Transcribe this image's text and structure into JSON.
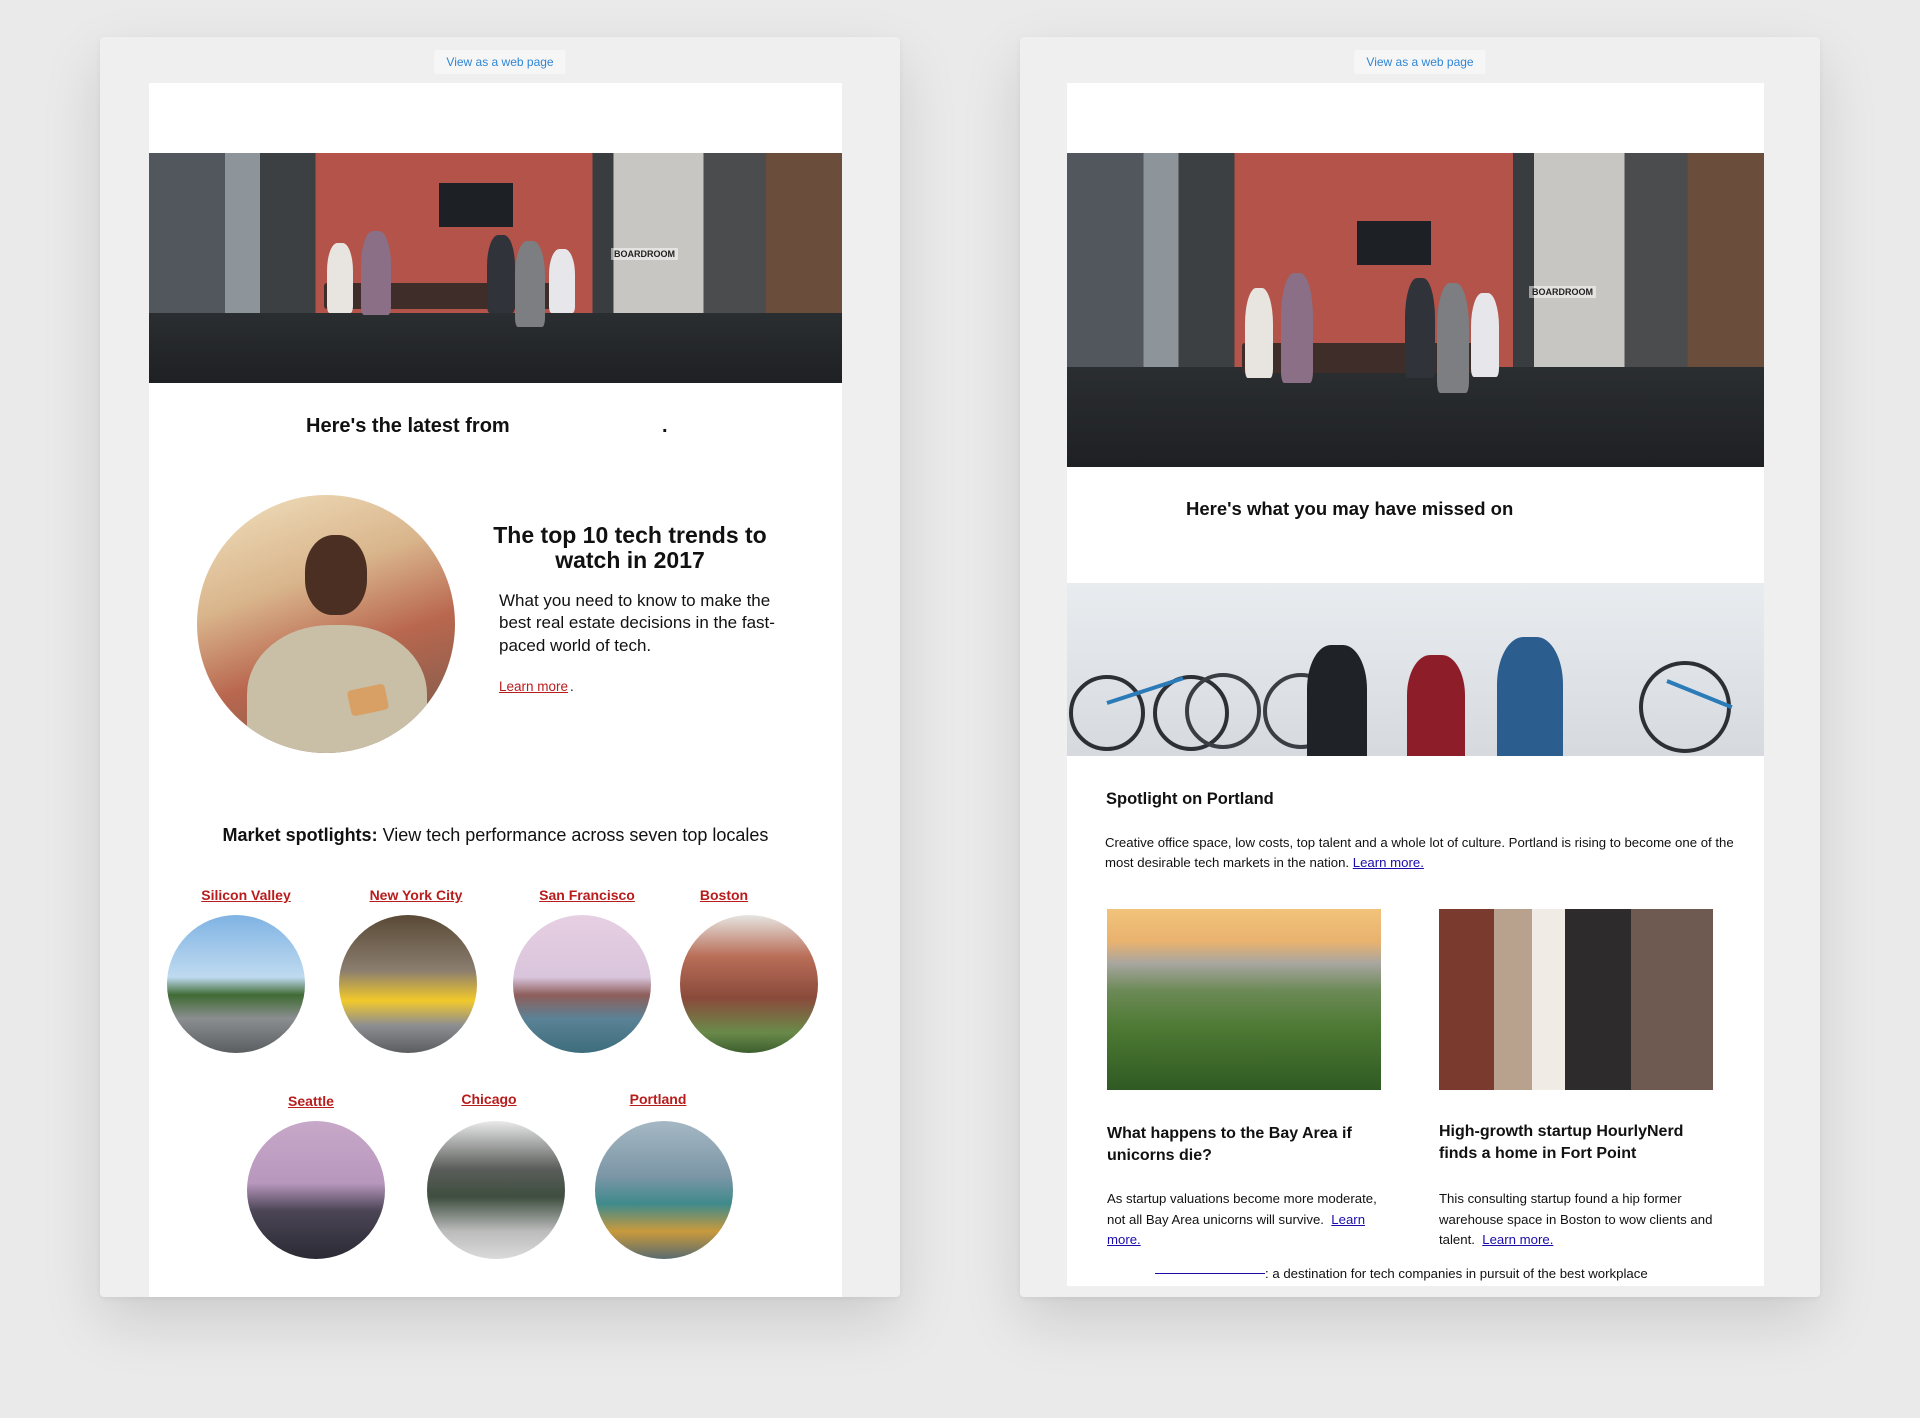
{
  "left_email": {
    "view_link": "View as a web page",
    "hero_sign": "BOARDROOM",
    "latest_heading": "Here's the latest from",
    "latest_trailing": ".",
    "feature": {
      "title": "The top 10 tech trends to watch in 2017",
      "body": "What you need to know to make the best real estate decisions in the fast-paced world of tech.",
      "link": "Learn more",
      "link_trailing": "."
    },
    "spotlights": {
      "label": "Market spotlights:",
      "text": " View tech performance across seven top locales",
      "cities": [
        "Silicon Valley",
        "New York City",
        "San Francisco",
        "Boston",
        "Seattle",
        "Chicago",
        "Portland"
      ]
    }
  },
  "right_email": {
    "view_link": "View as a web page",
    "hero_sign": "BOARDROOM",
    "missed_heading": "Here's what you may have missed on",
    "spotlight": {
      "title": "Spotlight on Portland",
      "body": "Creative office space, low costs, top talent and a whole lot of culture. Portland is rising to become one of the most desirable tech markets in the nation.",
      "link": "Learn more."
    },
    "articles": [
      {
        "title": "What happens to the Bay Area if unicorns die?",
        "body": "As startup valuations become more moderate, not all Bay Area unicorns will survive.",
        "link": "Learn more."
      },
      {
        "title": "High-growth startup HourlyNerd finds a home in Fort Point",
        "body": "This consulting startup found a hip former warehouse space in Boston to wow clients and talent.",
        "link": "Learn more."
      }
    ],
    "footer": ": a destination for tech companies in pursuit of the best workplace"
  },
  "colors": {
    "page_bg": "#eaeaeb",
    "card_bg": "#efefef",
    "link_red": "#b91c1c",
    "link_blue": "#1a0dab",
    "view_link": "#2f86d6"
  }
}
